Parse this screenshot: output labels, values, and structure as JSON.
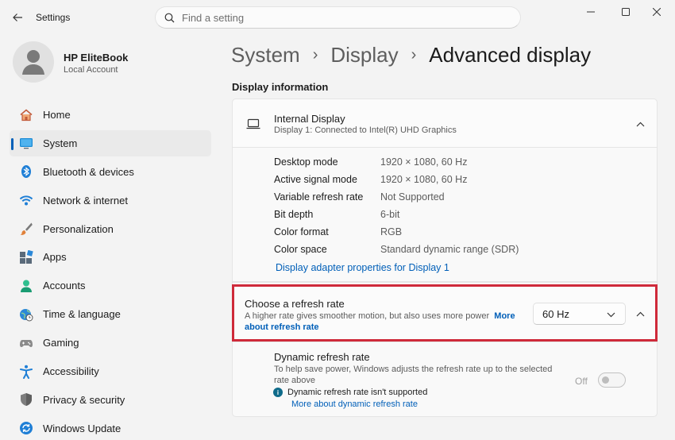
{
  "window": {
    "title": "Settings"
  },
  "search": {
    "placeholder": "Find a setting"
  },
  "profile": {
    "name": "HP EliteBook",
    "subtitle": "Local Account"
  },
  "nav": {
    "items": [
      {
        "label": "Home",
        "icon": "home-icon"
      },
      {
        "label": "System",
        "icon": "system-icon",
        "active": true
      },
      {
        "label": "Bluetooth & devices",
        "icon": "bluetooth-icon"
      },
      {
        "label": "Network & internet",
        "icon": "wifi-icon"
      },
      {
        "label": "Personalization",
        "icon": "brush-icon"
      },
      {
        "label": "Apps",
        "icon": "apps-icon"
      },
      {
        "label": "Accounts",
        "icon": "accounts-icon"
      },
      {
        "label": "Time & language",
        "icon": "clock-globe-icon"
      },
      {
        "label": "Gaming",
        "icon": "gamepad-icon"
      },
      {
        "label": "Accessibility",
        "icon": "accessibility-icon"
      },
      {
        "label": "Privacy & security",
        "icon": "shield-icon"
      },
      {
        "label": "Windows Update",
        "icon": "update-icon"
      }
    ]
  },
  "breadcrumb": {
    "items": [
      "System",
      "Display"
    ],
    "current": "Advanced display"
  },
  "section": {
    "title": "Display information"
  },
  "display": {
    "title": "Internal Display",
    "subtitle": "Display 1: Connected to Intel(R) UHD Graphics",
    "info": [
      {
        "label": "Desktop mode",
        "value": "1920 × 1080, 60 Hz"
      },
      {
        "label": "Active signal mode",
        "value": "1920 × 1080, 60 Hz"
      },
      {
        "label": "Variable refresh rate",
        "value": "Not Supported"
      },
      {
        "label": "Bit depth",
        "value": "6-bit"
      },
      {
        "label": "Color format",
        "value": "RGB"
      },
      {
        "label": "Color space",
        "value": "Standard dynamic range (SDR)"
      }
    ],
    "adapter_link": "Display adapter properties for Display 1"
  },
  "refresh": {
    "title": "Choose a refresh rate",
    "description": "A higher rate gives smoother motion, but also uses more power",
    "link": "More about refresh rate",
    "selected": "60 Hz"
  },
  "dynamic": {
    "title": "Dynamic refresh rate",
    "description": "To help save power, Windows adjusts the refresh rate up to the selected rate above",
    "note": "Dynamic refresh rate isn't supported",
    "link": "More about dynamic refresh rate",
    "toggle_label": "Off"
  },
  "colors": {
    "accent": "#005fb8",
    "highlight": "#cf2a3a"
  }
}
